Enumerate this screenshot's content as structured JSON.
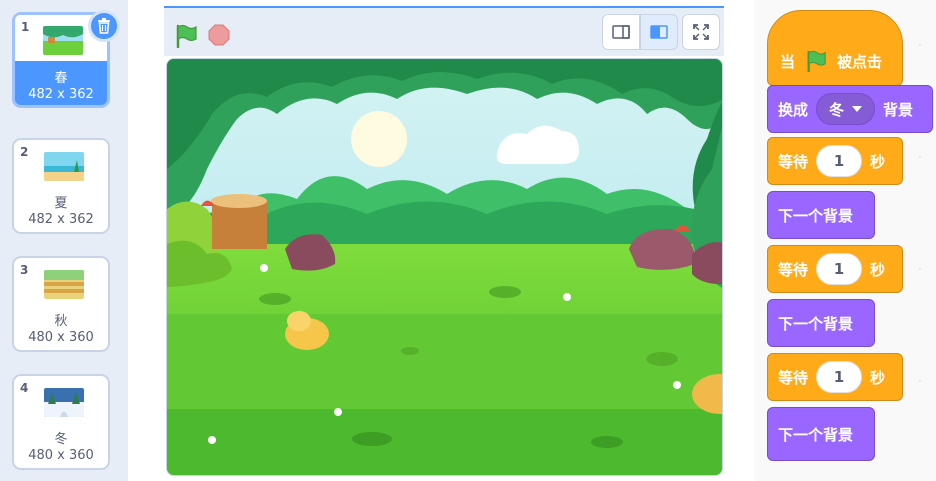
{
  "backdrops": [
    {
      "num": "1",
      "name": "春",
      "size": "482 x 362"
    },
    {
      "num": "2",
      "name": "夏",
      "size": "482 x 362"
    },
    {
      "num": "3",
      "name": "秋",
      "size": "480 x 360"
    },
    {
      "num": "4",
      "name": "冬",
      "size": "480 x 360"
    }
  ],
  "selected_backdrop": 0,
  "icons": {
    "delete": "trash-icon",
    "flag": "green-flag-icon",
    "stop": "stop-icon",
    "small_stage": "small-stage-icon",
    "large_stage": "large-stage-icon",
    "fullscreen": "fullscreen-icon"
  },
  "colors": {
    "events": "#ffab19",
    "control": "#ffab19",
    "looks": "#9966ff",
    "selection": "#4c97ff",
    "flag": "#4cbf56",
    "stop": "#ec9c9c"
  },
  "script": {
    "hat": {
      "prefix": "当",
      "suffix": "被点击"
    },
    "switch": {
      "label": "换成",
      "value": "冬",
      "suffix": "背景"
    },
    "wait1": {
      "label": "等待",
      "value": "1",
      "unit": "秒"
    },
    "next1": {
      "label": "下一个背景"
    },
    "wait2": {
      "label": "等待",
      "value": "1",
      "unit": "秒"
    },
    "next2": {
      "label": "下一个背景"
    },
    "wait3": {
      "label": "等待",
      "value": "1",
      "unit": "秒"
    },
    "next3": {
      "label": "下一个背景"
    }
  }
}
